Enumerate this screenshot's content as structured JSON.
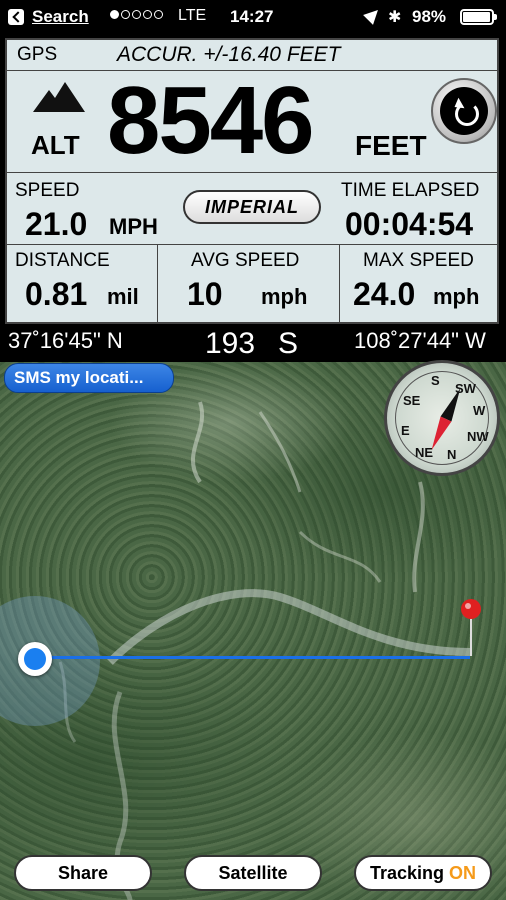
{
  "status_bar": {
    "back_label": "Search",
    "carrier": "LTE",
    "time": "14:27",
    "battery": "98%",
    "battery_level": 0.98,
    "signal_bars": 1
  },
  "panel": {
    "gps_label": "GPS",
    "accuracy": "ACCUR. +/-16.40 FEET",
    "alt_label": "ALT",
    "altitude": "8546",
    "alt_unit": "FEET",
    "speed_label": "SPEED",
    "speed": "21.0",
    "speed_unit": "MPH",
    "units_button": "IMPERIAL",
    "time_label": "TIME ELAPSED",
    "time_elapsed": "00:04:54",
    "distance_label": "DISTANCE",
    "distance": "0.81",
    "distance_unit": "mil",
    "avg_label": "AVG SPEED",
    "avg_speed": "10",
    "avg_unit": "mph",
    "max_label": "MAX SPEED",
    "max_speed": "24.0",
    "max_unit": "mph"
  },
  "coords": {
    "latitude": "37˚16'45\" N",
    "heading": "193",
    "direction": "S",
    "longitude": "108˚27'44\" W"
  },
  "map": {
    "sms_button": "SMS my locati...",
    "compass_labels": [
      "S",
      "SW",
      "W",
      "NW",
      "N",
      "NE",
      "E",
      "SE"
    ],
    "route_color": "#1a6fe8",
    "pin_color": "#e02020"
  },
  "bottom": {
    "share": "Share",
    "satellite": "Satellite",
    "tracking": "Tracking",
    "tracking_state": "ON"
  }
}
